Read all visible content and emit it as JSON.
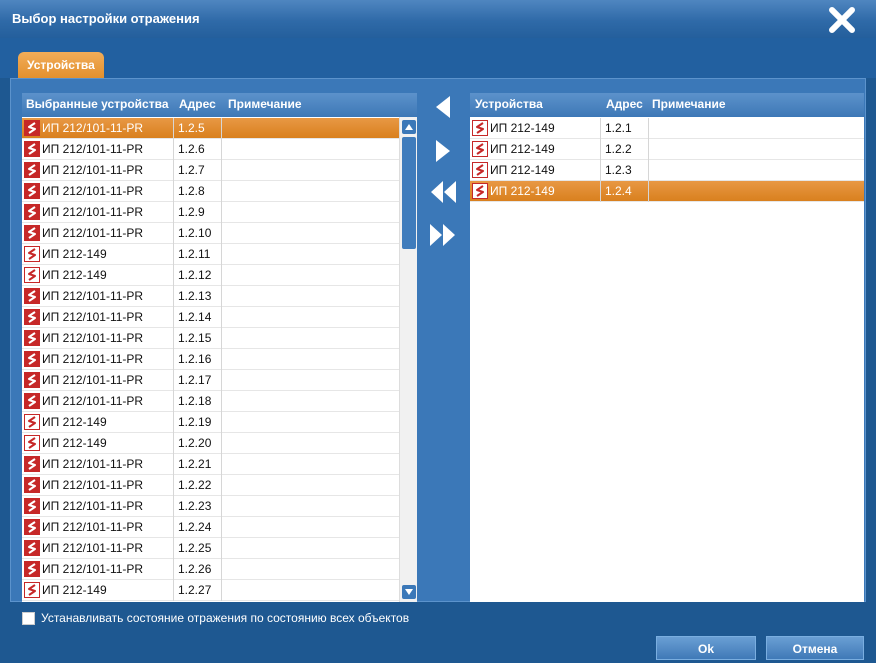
{
  "window": {
    "title": "Выбор настройки отражения"
  },
  "tabs": [
    {
      "label": "Устройства",
      "active": true
    }
  ],
  "left_table": {
    "columns": [
      "Выбранные устройства",
      "Адрес",
      "Примечание"
    ],
    "rows": [
      {
        "name": "ИП 212/101-11-PR",
        "addr": "1.2.5",
        "note": "",
        "icon": "device-red-icon",
        "selected": true
      },
      {
        "name": "ИП 212/101-11-PR",
        "addr": "1.2.6",
        "note": "",
        "icon": "device-red-icon"
      },
      {
        "name": "ИП 212/101-11-PR",
        "addr": "1.2.7",
        "note": "",
        "icon": "device-red-icon"
      },
      {
        "name": "ИП 212/101-11-PR",
        "addr": "1.2.8",
        "note": "",
        "icon": "device-red-icon"
      },
      {
        "name": "ИП 212/101-11-PR",
        "addr": "1.2.9",
        "note": "",
        "icon": "device-red-icon"
      },
      {
        "name": "ИП 212/101-11-PR",
        "addr": "1.2.10",
        "note": "",
        "icon": "device-red-icon"
      },
      {
        "name": "ИП 212-149",
        "addr": "1.2.11",
        "note": "",
        "icon": "device-outline-icon"
      },
      {
        "name": "ИП 212-149",
        "addr": "1.2.12",
        "note": "",
        "icon": "device-outline-icon"
      },
      {
        "name": "ИП 212/101-11-PR",
        "addr": "1.2.13",
        "note": "",
        "icon": "device-red-icon"
      },
      {
        "name": "ИП 212/101-11-PR",
        "addr": "1.2.14",
        "note": "",
        "icon": "device-red-icon"
      },
      {
        "name": "ИП 212/101-11-PR",
        "addr": "1.2.15",
        "note": "",
        "icon": "device-red-icon"
      },
      {
        "name": "ИП 212/101-11-PR",
        "addr": "1.2.16",
        "note": "",
        "icon": "device-red-icon"
      },
      {
        "name": "ИП 212/101-11-PR",
        "addr": "1.2.17",
        "note": "",
        "icon": "device-red-icon"
      },
      {
        "name": "ИП 212/101-11-PR",
        "addr": "1.2.18",
        "note": "",
        "icon": "device-red-icon"
      },
      {
        "name": "ИП 212-149",
        "addr": "1.2.19",
        "note": "",
        "icon": "device-outline-icon"
      },
      {
        "name": "ИП 212-149",
        "addr": "1.2.20",
        "note": "",
        "icon": "device-outline-icon"
      },
      {
        "name": "ИП 212/101-11-PR",
        "addr": "1.2.21",
        "note": "",
        "icon": "device-red-icon"
      },
      {
        "name": "ИП 212/101-11-PR",
        "addr": "1.2.22",
        "note": "",
        "icon": "device-red-icon"
      },
      {
        "name": "ИП 212/101-11-PR",
        "addr": "1.2.23",
        "note": "",
        "icon": "device-red-icon"
      },
      {
        "name": "ИП 212/101-11-PR",
        "addr": "1.2.24",
        "note": "",
        "icon": "device-red-icon"
      },
      {
        "name": "ИП 212/101-11-PR",
        "addr": "1.2.25",
        "note": "",
        "icon": "device-red-icon"
      },
      {
        "name": "ИП 212/101-11-PR",
        "addr": "1.2.26",
        "note": "",
        "icon": "device-red-icon"
      },
      {
        "name": "ИП 212-149",
        "addr": "1.2.27",
        "note": "",
        "icon": "device-outline-icon"
      }
    ]
  },
  "right_table": {
    "columns": [
      "Устройства",
      "Адрес",
      "Примечание"
    ],
    "rows": [
      {
        "name": "ИП 212-149",
        "addr": "1.2.1",
        "note": "",
        "icon": "device-outline-icon"
      },
      {
        "name": "ИП 212-149",
        "addr": "1.2.2",
        "note": "",
        "icon": "device-outline-icon"
      },
      {
        "name": "ИП 212-149",
        "addr": "1.2.3",
        "note": "",
        "icon": "device-outline-icon"
      },
      {
        "name": "ИП 212-149",
        "addr": "1.2.4",
        "note": "",
        "icon": "device-outline-icon",
        "selected": true
      }
    ]
  },
  "transfer_buttons": [
    "move-left-icon",
    "move-right-icon",
    "move-all-left-icon",
    "move-all-right-icon"
  ],
  "footer": {
    "checkbox_label": "Устанавливать состояние отражения по состоянию всех объектов",
    "checked": false
  },
  "buttons": {
    "ok": "Ok",
    "cancel": "Отмена"
  },
  "colors": {
    "accent": "#e28f2c",
    "window": "#1e5891",
    "panel": "#3b78b8"
  }
}
